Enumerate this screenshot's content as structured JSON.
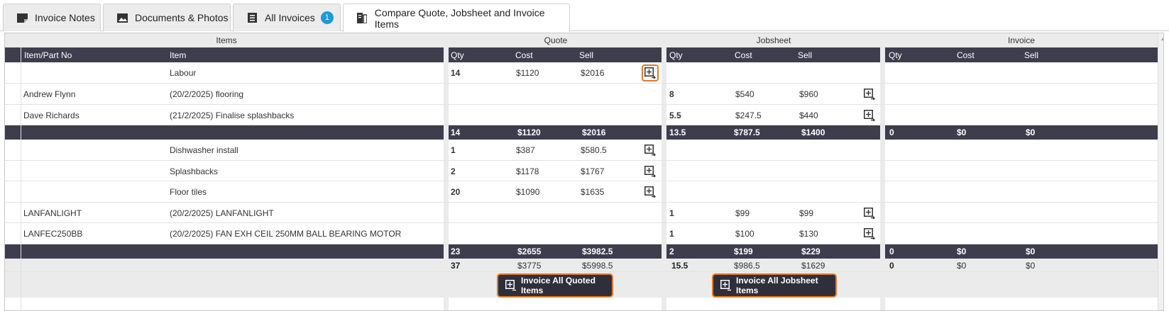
{
  "tabs": [
    {
      "label": "Invoice Notes",
      "icon": "note-icon"
    },
    {
      "label": "Documents & Photos",
      "icon": "photo-icon"
    },
    {
      "label": "All Invoices",
      "icon": "list-icon",
      "badge": "1"
    },
    {
      "label": "Compare Quote, Jobsheet and Invoice Items",
      "icon": "compare-icon"
    }
  ],
  "groups": {
    "items": "Items",
    "quote": "Quote",
    "jobsheet": "Jobsheet",
    "invoice": "Invoice"
  },
  "columns": {
    "part_no": "Item/Part No",
    "item": "Item",
    "qty": "Qty",
    "cost": "Cost",
    "sell": "Sell"
  },
  "rows": [
    {
      "part": "",
      "item": "Labour",
      "quote": {
        "qty": "14",
        "cost": "$1120",
        "sell": "$2016"
      },
      "job": null,
      "quote_btn_highlight": true
    },
    {
      "part": "Andrew Flynn",
      "item": "(20/2/2025) flooring",
      "quote": null,
      "job": {
        "qty": "8",
        "cost": "$540",
        "sell": "$960"
      }
    },
    {
      "part": "Dave Richards",
      "item": "(21/2/2025) Finalise splashbacks",
      "quote": null,
      "job": {
        "qty": "5.5",
        "cost": "$247.5",
        "sell": "$440"
      }
    },
    {
      "subtotal": true,
      "quote": {
        "qty": "14",
        "cost": "$1120",
        "sell": "$2016"
      },
      "job": {
        "qty": "13.5",
        "cost": "$787.5",
        "sell": "$1400"
      },
      "invoice": {
        "qty": "0",
        "cost": "$0",
        "sell": "$0"
      }
    },
    {
      "part": "",
      "item": "Dishwasher install",
      "quote": {
        "qty": "1",
        "cost": "$387",
        "sell": "$580.5"
      },
      "job": null
    },
    {
      "part": "",
      "item": "Splashbacks",
      "quote": {
        "qty": "2",
        "cost": "$1178",
        "sell": "$1767"
      },
      "job": null
    },
    {
      "part": "",
      "item": "Floor tiles",
      "quote": {
        "qty": "20",
        "cost": "$1090",
        "sell": "$1635"
      },
      "job": null
    },
    {
      "part": "LANFANLIGHT",
      "item": "(20/2/2025) LANFANLIGHT",
      "quote": null,
      "job": {
        "qty": "1",
        "cost": "$99",
        "sell": "$99"
      }
    },
    {
      "part": "LANFEC250BB",
      "item": "(20/2/2025) FAN EXH CEIL 250MM BALL BEARING MOTOR",
      "quote": null,
      "job": {
        "qty": "1",
        "cost": "$100",
        "sell": "$130"
      }
    },
    {
      "subtotal": true,
      "quote": {
        "qty": "23",
        "cost": "$2655",
        "sell": "$3982.5"
      },
      "job": {
        "qty": "2",
        "cost": "$199",
        "sell": "$229"
      },
      "invoice": {
        "qty": "0",
        "cost": "$0",
        "sell": "$0"
      }
    }
  ],
  "totals": {
    "quote": {
      "qty": "37",
      "cost": "$3775",
      "sell": "$5998.5"
    },
    "job": {
      "qty": "15.5",
      "cost": "$986.5",
      "sell": "$1629"
    },
    "invoice": {
      "qty": "0",
      "cost": "$0",
      "sell": "$0"
    }
  },
  "buttons": {
    "invoice_quoted": "Invoice All Quoted Items",
    "invoice_jobsheet": "Invoice All Jobsheet Items"
  },
  "colors": {
    "header_dark": "#3d3d4e",
    "highlight": "#e07b27",
    "badge": "#1a9bd7"
  }
}
